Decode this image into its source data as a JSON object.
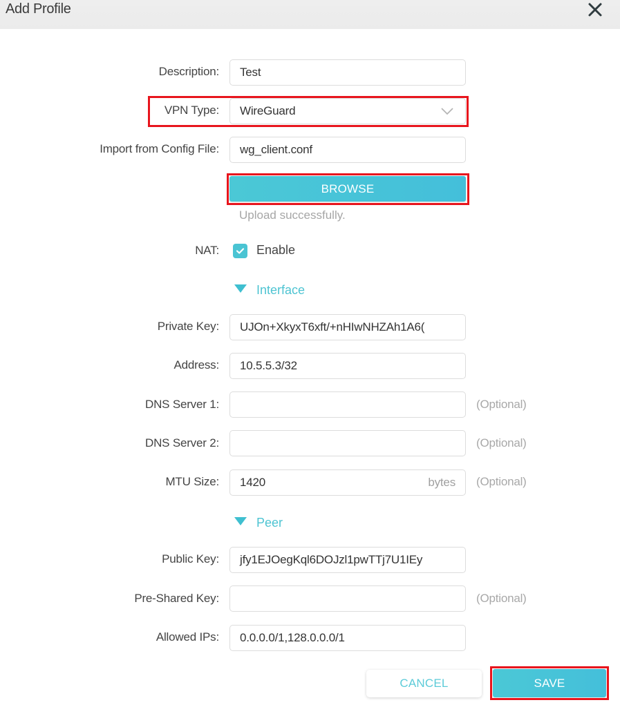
{
  "dialog": {
    "title": "Add Profile",
    "close_icon": "close-icon"
  },
  "form": {
    "description": {
      "label": "Description:",
      "value": "Test"
    },
    "vpn_type": {
      "label": "VPN Type:",
      "value": "WireGuard",
      "icon": "chevron-down-icon"
    },
    "import_config": {
      "label": "Import from Config File:",
      "value": "wg_client.conf"
    },
    "browse_label": "BROWSE",
    "upload_status": "Upload successfully.",
    "nat": {
      "label": "NAT:",
      "checkbox_label": "Enable",
      "checked": true
    },
    "interface_section": "Interface",
    "private_key": {
      "label": "Private Key:",
      "value": "UJOn+XkyxT6xft/+nHIwNHZAh1A6("
    },
    "address": {
      "label": "Address:",
      "value": "10.5.5.3/32"
    },
    "dns1": {
      "label": "DNS Server 1:",
      "value": "",
      "hint": "(Optional)"
    },
    "dns2": {
      "label": "DNS Server 2:",
      "value": "",
      "hint": "(Optional)"
    },
    "mtu": {
      "label": "MTU Size:",
      "value": "1420",
      "unit": "bytes",
      "hint": "(Optional)"
    },
    "peer_section": "Peer",
    "public_key": {
      "label": "Public Key:",
      "value": "jfy1EJOegKql6DOJzl1pwTTj7U1IEy"
    },
    "psk": {
      "label": "Pre-Shared Key:",
      "value": "",
      "hint": "(Optional)"
    },
    "allowed_ips": {
      "label": "Allowed IPs:",
      "value": "0.0.0.0/1,128.0.0.0/1"
    }
  },
  "footer": {
    "cancel_label": "CANCEL",
    "save_label": "SAVE"
  },
  "colors": {
    "accent": "#4ac4d3",
    "highlight": "#e8151d"
  }
}
